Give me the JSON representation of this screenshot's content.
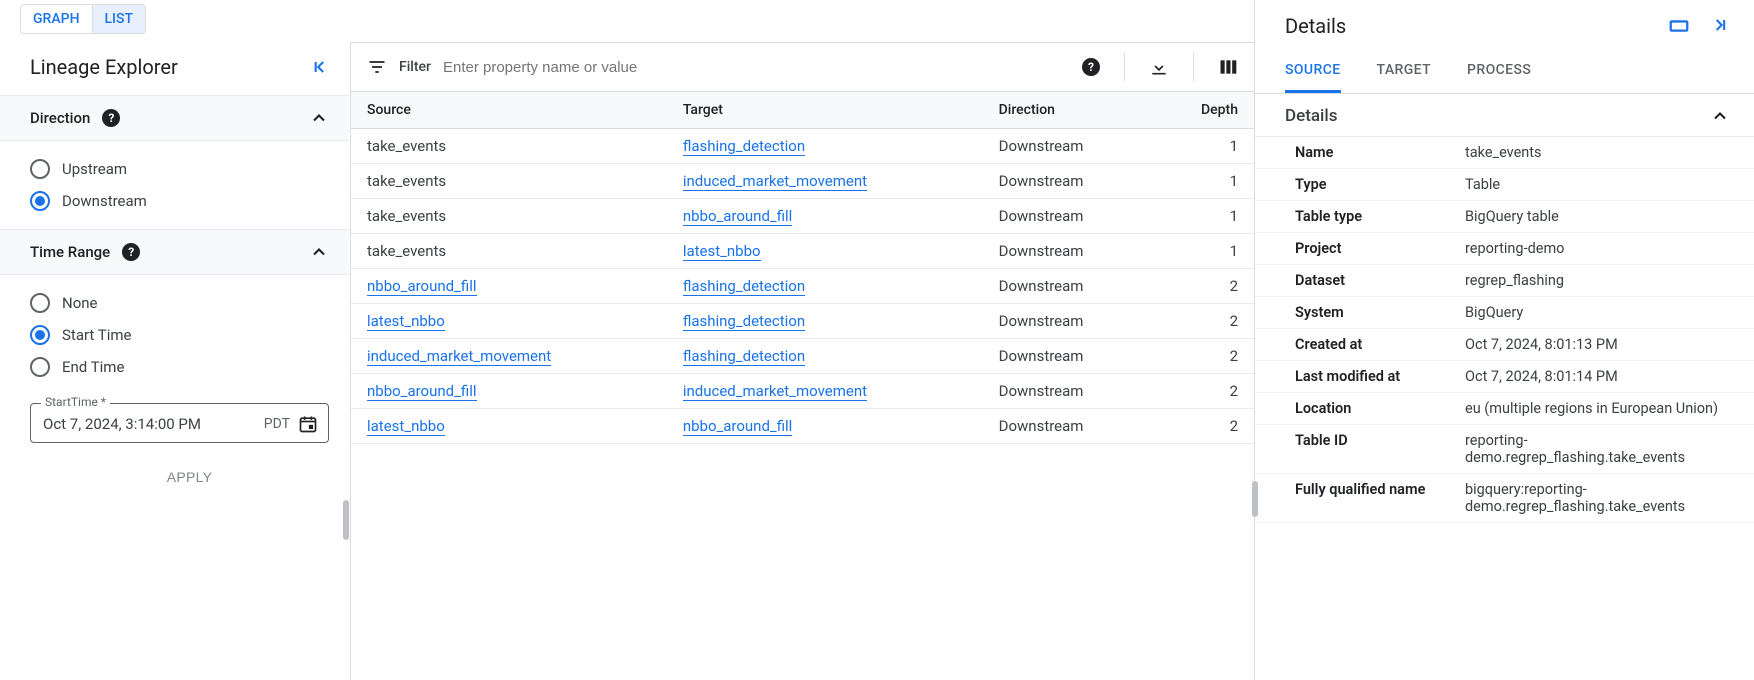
{
  "view_tabs": {
    "graph": "GRAPH",
    "list": "LIST",
    "active": "list"
  },
  "sidebar": {
    "title": "Lineage Explorer",
    "direction": {
      "label": "Direction",
      "options": {
        "upstream": "Upstream",
        "downstream": "Downstream"
      },
      "selected": "downstream"
    },
    "time_range": {
      "label": "Time Range",
      "options": {
        "none": "None",
        "start": "Start Time",
        "end": "End Time"
      },
      "selected": "start"
    },
    "start_time": {
      "label": "StartTime *",
      "value": "Oct 7, 2024, 3:14:00 PM",
      "tz": "PDT"
    },
    "apply": "APPLY"
  },
  "filter": {
    "label": "Filter",
    "placeholder": "Enter property name or value"
  },
  "table": {
    "columns": {
      "source": "Source",
      "target": "Target",
      "direction": "Direction",
      "depth": "Depth"
    },
    "rows": [
      {
        "source": "take_events",
        "source_link": false,
        "target": "flashing_detection",
        "direction": "Downstream",
        "depth": 1
      },
      {
        "source": "take_events",
        "source_link": false,
        "target": "induced_market_movement",
        "direction": "Downstream",
        "depth": 1
      },
      {
        "source": "take_events",
        "source_link": false,
        "target": "nbbo_around_fill",
        "direction": "Downstream",
        "depth": 1
      },
      {
        "source": "take_events",
        "source_link": false,
        "target": "latest_nbbo",
        "direction": "Downstream",
        "depth": 1
      },
      {
        "source": "nbbo_around_fill",
        "source_link": true,
        "target": "flashing_detection",
        "direction": "Downstream",
        "depth": 2
      },
      {
        "source": "latest_nbbo",
        "source_link": true,
        "target": "flashing_detection",
        "direction": "Downstream",
        "depth": 2
      },
      {
        "source": "induced_market_movement",
        "source_link": true,
        "target": "flashing_detection",
        "direction": "Downstream",
        "depth": 2
      },
      {
        "source": "nbbo_around_fill",
        "source_link": true,
        "target": "induced_market_movement",
        "direction": "Downstream",
        "depth": 2
      },
      {
        "source": "latest_nbbo",
        "source_link": true,
        "target": "nbbo_around_fill",
        "direction": "Downstream",
        "depth": 2
      }
    ]
  },
  "details": {
    "title": "Details",
    "tabs": {
      "source": "SOURCE",
      "target": "TARGET",
      "process": "PROCESS",
      "active": "source"
    },
    "section_title": "Details",
    "fields": [
      {
        "k": "Name",
        "v": "take_events"
      },
      {
        "k": "Type",
        "v": "Table"
      },
      {
        "k": "Table type",
        "v": "BigQuery table"
      },
      {
        "k": "Project",
        "v": "reporting-demo"
      },
      {
        "k": "Dataset",
        "v": "regrep_flashing"
      },
      {
        "k": "System",
        "v": "BigQuery"
      },
      {
        "k": "Created at",
        "v": "Oct 7, 2024, 8:01:13 PM"
      },
      {
        "k": "Last modified at",
        "v": "Oct 7, 2024, 8:01:14 PM"
      },
      {
        "k": "Location",
        "v": "eu (multiple regions in European Union)"
      },
      {
        "k": "Table ID",
        "v": "reporting-demo.regrep_flashing.take_events"
      },
      {
        "k": "Fully qualified name",
        "v": "bigquery:reporting-demo.regrep_flashing.take_events"
      }
    ]
  }
}
